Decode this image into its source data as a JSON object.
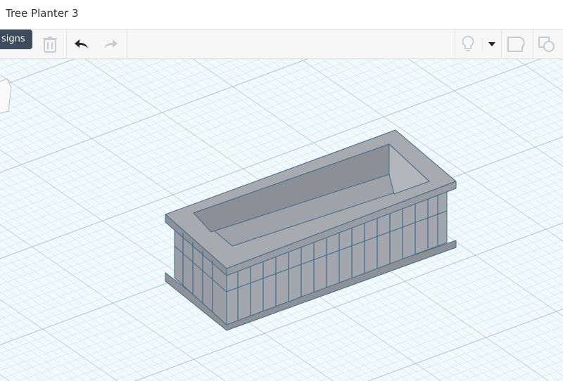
{
  "header": {
    "title": "Tree Planter 3"
  },
  "toolbar": {
    "tooltip": "signs",
    "icons": [
      "delete-icon",
      "undo-icon",
      "redo-icon",
      "lightbulb-icon",
      "dropdown-arrow-icon",
      "group-icon",
      "ungroup-icon"
    ]
  },
  "workplane": {
    "grid_color": "#9fd2e0",
    "shape_color": "#9a9ea4",
    "edge_color": "#3e6a8a"
  }
}
